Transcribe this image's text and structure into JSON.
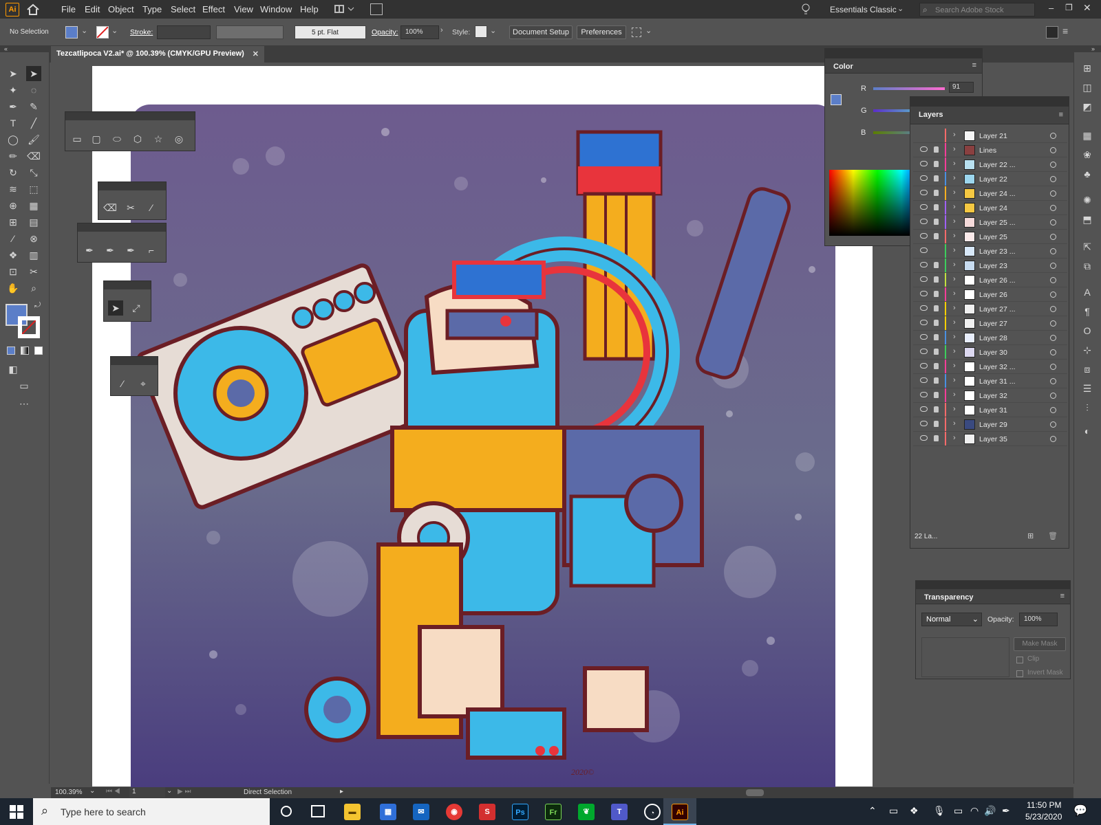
{
  "app": {
    "logo": "Ai",
    "workspace": "Essentials Classic",
    "search_placeholder": "Search Adobe Stock"
  },
  "menu": [
    "File",
    "Edit",
    "Object",
    "Type",
    "Select",
    "Effect",
    "View",
    "Window",
    "Help"
  ],
  "options": {
    "selection_label": "No Selection",
    "stroke_label": "Stroke:",
    "brush": "5 pt. Flat",
    "opacity_label": "Opacity:",
    "opacity": "100%",
    "style_label": "Style:",
    "document_setup": "Document Setup",
    "preferences": "Preferences"
  },
  "document": {
    "tab_title": "Tezcatlipoca V2.ai* @ 100.39% (CMYK/GPU Preview)"
  },
  "color_panel": {
    "title": "Color",
    "r_label": "R",
    "r_value": "91",
    "g_label": "G",
    "b_label": "B",
    "fill_color": "#5b7ec8"
  },
  "layers_panel": {
    "title": "Layers",
    "footer": "22 La...",
    "layers": [
      {
        "name": "Layer 21",
        "color": "#ff6b6b",
        "eye": false,
        "lock": false,
        "thumb": "#f5f5f5"
      },
      {
        "name": "Lines",
        "color": "#ff3d9a",
        "eye": true,
        "lock": true,
        "thumb": "#8a4040"
      },
      {
        "name": "Layer 22 ...",
        "color": "#ff3d9a",
        "eye": true,
        "lock": true,
        "thumb": "#b8e0f0"
      },
      {
        "name": "Layer 22",
        "color": "#4a90e2",
        "eye": true,
        "lock": true,
        "thumb": "#9cd6ee"
      },
      {
        "name": "Layer 24 ...",
        "color": "#ffb020",
        "eye": true,
        "lock": true,
        "thumb": "#f5c842"
      },
      {
        "name": "Layer 24",
        "color": "#a060ff",
        "eye": true,
        "lock": true,
        "thumb": "#f5c842"
      },
      {
        "name": "Layer 25 ...",
        "color": "#a060ff",
        "eye": true,
        "lock": true,
        "thumb": "#f5dada"
      },
      {
        "name": "Layer 25",
        "color": "#ff6b6b",
        "eye": true,
        "lock": true,
        "thumb": "#fbeaea"
      },
      {
        "name": "Layer 23 ...",
        "color": "#3ccf5c",
        "eye": true,
        "lock": false,
        "thumb": "#d8e8f8"
      },
      {
        "name": "Layer 23",
        "color": "#3ccf5c",
        "eye": true,
        "lock": true,
        "thumb": "#c8dcf0"
      },
      {
        "name": "Layer 26 ...",
        "color": "#c2e040",
        "eye": true,
        "lock": true,
        "thumb": "#ffffff"
      },
      {
        "name": "Layer 26",
        "color": "#ff3d9a",
        "eye": true,
        "lock": true,
        "thumb": "#ffffff"
      },
      {
        "name": "Layer 27 ...",
        "color": "#ffd000",
        "eye": true,
        "lock": true,
        "thumb": "#f0f0f0"
      },
      {
        "name": "Layer 27",
        "color": "#ffd000",
        "eye": true,
        "lock": true,
        "thumb": "#f0f0f0"
      },
      {
        "name": "Layer 28",
        "color": "#4a90e2",
        "eye": true,
        "lock": true,
        "thumb": "#e8eefc"
      },
      {
        "name": "Layer 30",
        "color": "#3ccf5c",
        "eye": true,
        "lock": true,
        "thumb": "#dcd8f0"
      },
      {
        "name": "Layer 32 ...",
        "color": "#ff3d9a",
        "eye": true,
        "lock": true,
        "thumb": "#ffffff"
      },
      {
        "name": "Layer 31 ...",
        "color": "#4a90e2",
        "eye": true,
        "lock": true,
        "thumb": "#ffffff"
      },
      {
        "name": "Layer 32",
        "color": "#ff3d9a",
        "eye": true,
        "lock": true,
        "thumb": "#ffffff"
      },
      {
        "name": "Layer 31",
        "color": "#ff6b6b",
        "eye": true,
        "lock": true,
        "thumb": "#ffffff"
      },
      {
        "name": "Layer 29",
        "color": "#ff6b6b",
        "eye": true,
        "lock": true,
        "thumb": "#3a4a80"
      },
      {
        "name": "Layer 35",
        "color": "#ff6b6b",
        "eye": true,
        "lock": true,
        "thumb": "#f0f0f0"
      }
    ]
  },
  "transparency_panel": {
    "title": "Transparency",
    "blend_mode": "Normal",
    "opacity_label": "Opacity:",
    "opacity": "100%",
    "make_mask": "Make Mask",
    "clip": "Clip",
    "invert_mask": "Invert Mask"
  },
  "status": {
    "zoom": "100.39%",
    "artboard": "1",
    "tool": "Direct Selection"
  },
  "taskbar": {
    "search_placeholder": "Type here to search",
    "time": "11:50 PM",
    "date": "5/23/2020"
  },
  "artwork": {
    "signature": "2020©"
  }
}
